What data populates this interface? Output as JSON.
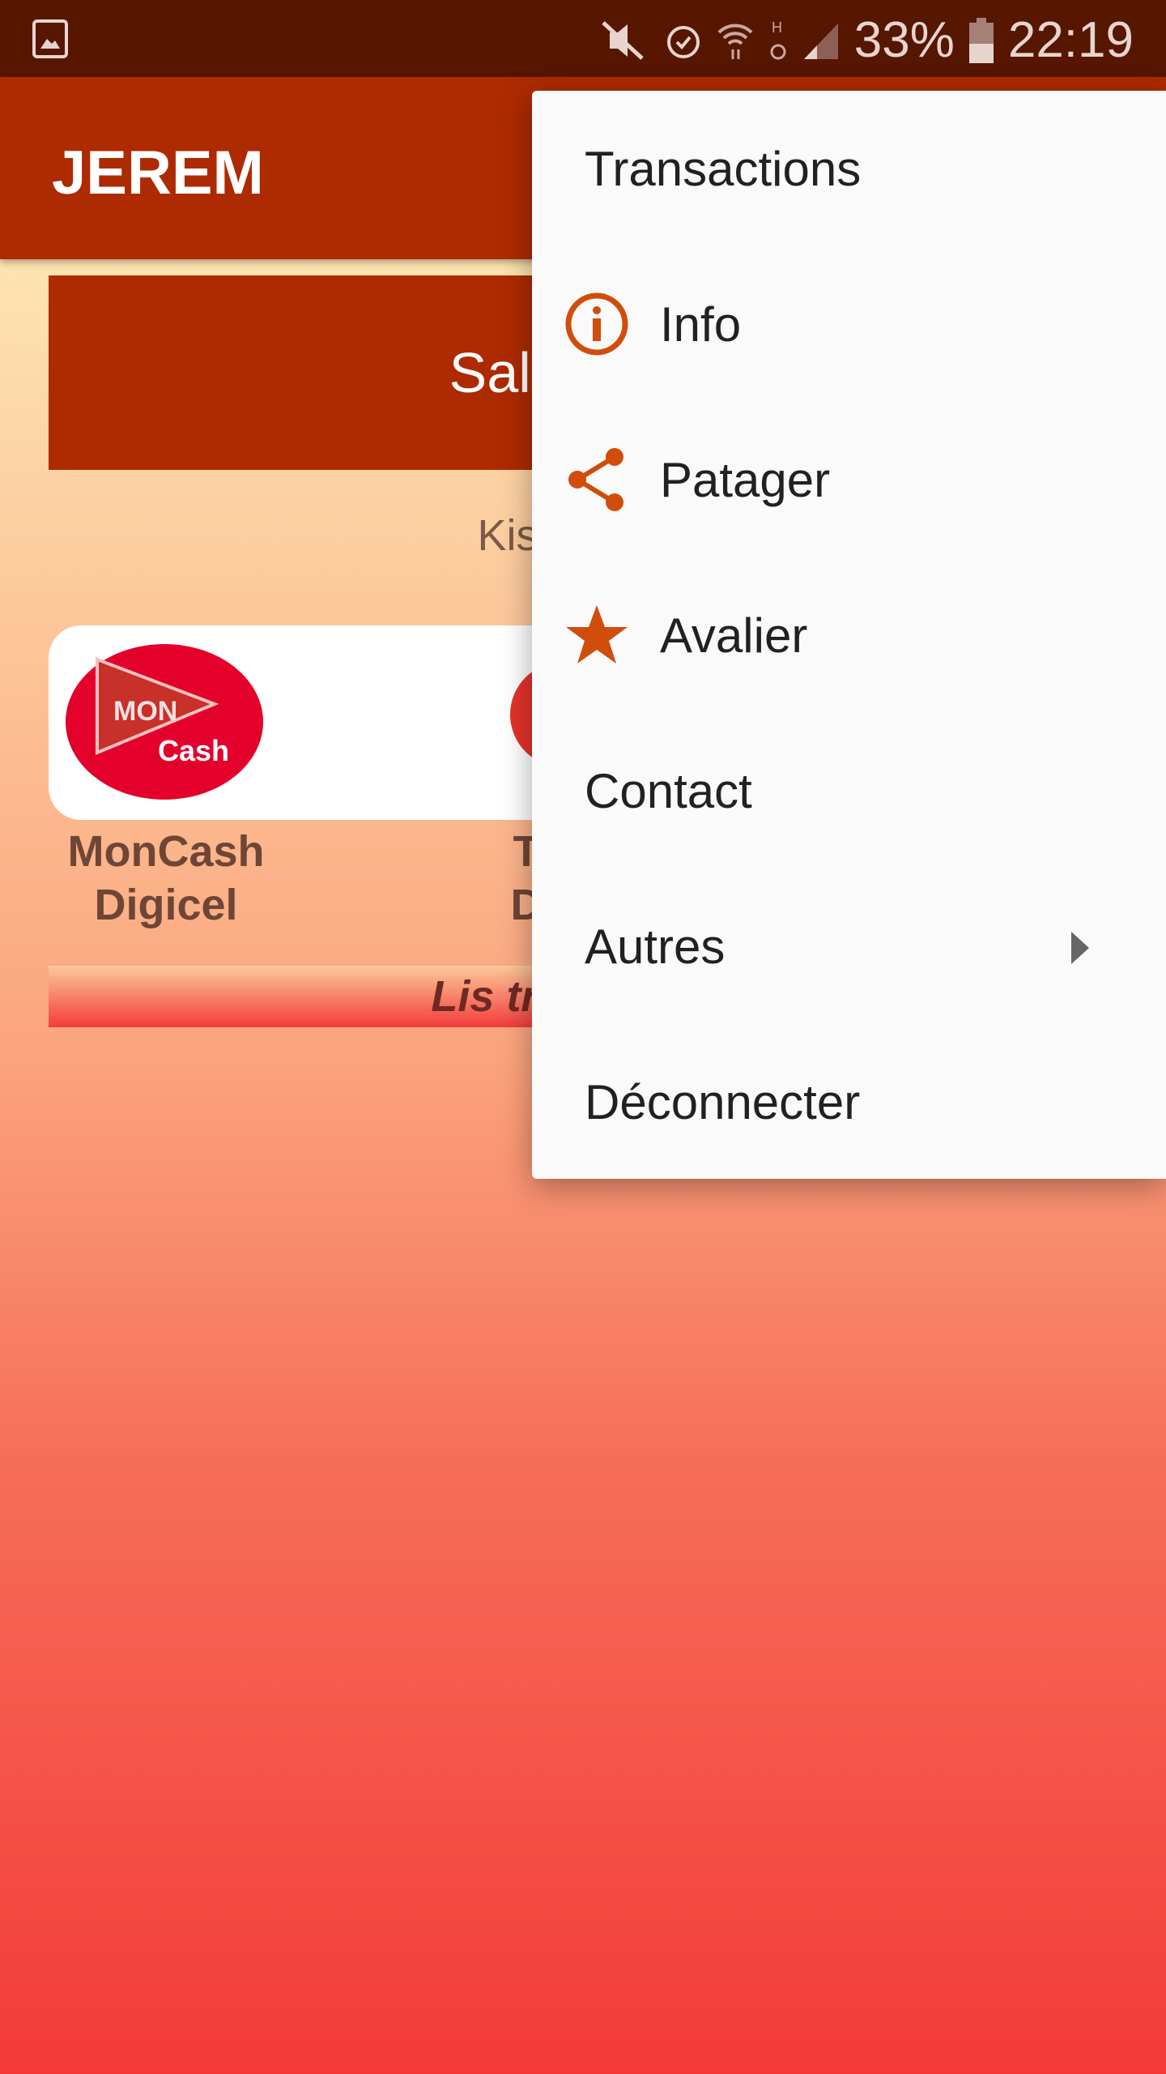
{
  "status_bar": {
    "battery": "33%",
    "time": "22:19",
    "icons": [
      "gallery-icon",
      "mute-icon",
      "alarm-icon",
      "wifi-icon",
      "hspa-icon",
      "signal-icon",
      "battery-icon"
    ]
  },
  "app_bar": {
    "title": "JEREM"
  },
  "main": {
    "banner": "Salut! tes t",
    "prompt": "Kisa wap v",
    "services": [
      {
        "name": "MonCash Digicel",
        "line1": "MonCash",
        "line2": "Digicel",
        "logo_text_top": "MON",
        "logo_text_bottom": "Cash"
      },
      {
        "line1": "T",
        "line2": "D"
      }
    ],
    "transactions_link": "Lis tranzaksyo"
  },
  "menu": {
    "items": [
      {
        "label": "Transactions"
      },
      {
        "label": "Info",
        "icon": "info-icon"
      },
      {
        "label": "Patager",
        "icon": "share-icon"
      },
      {
        "label": "Avalier",
        "icon": "star-icon"
      },
      {
        "label": "Contact"
      },
      {
        "label": "Autres",
        "submenu": true
      },
      {
        "label": "Déconnecter"
      }
    ]
  },
  "colors": {
    "status_bar": "#561600",
    "app_bar": "#ae2a00",
    "accent": "#d14d0c",
    "menu_bg": "#fafafa"
  }
}
